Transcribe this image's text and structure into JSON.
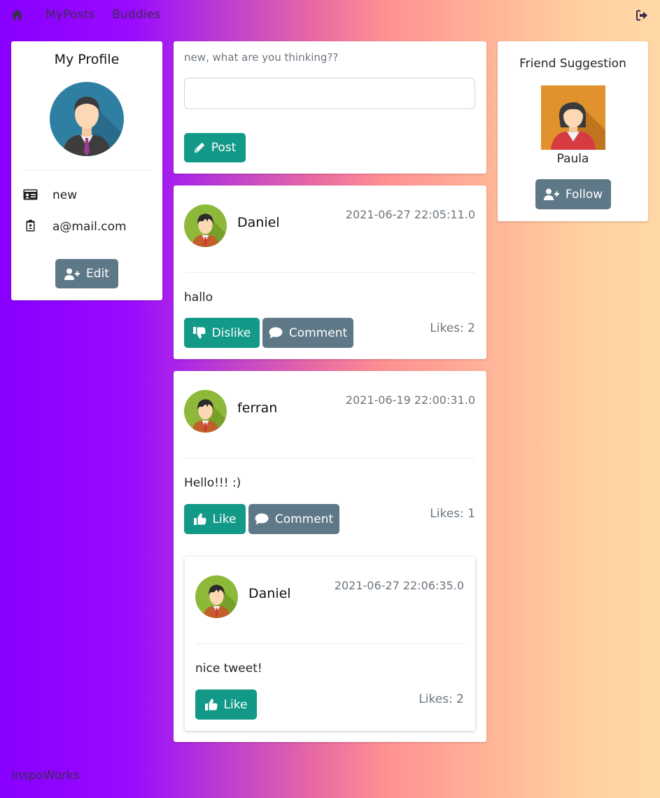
{
  "nav": {
    "home_icon": "home-icon",
    "myposts": "MyPosts",
    "buddies": "Buddies",
    "logout_icon": "sign-out-icon"
  },
  "profile": {
    "title": "My Profile",
    "username": "new",
    "email": "a@mail.com",
    "edit_label": "Edit"
  },
  "composer": {
    "prompt": "new, what are you thinking??",
    "input_value": "",
    "post_label": "Post"
  },
  "posts": [
    {
      "author": "Daniel",
      "timestamp": "2021-06-27 22:05:11.0",
      "text": "hallo",
      "like_label": "Dislike",
      "comment_label": "Comment",
      "likes": "Likes: 2"
    },
    {
      "author": "ferran",
      "timestamp": "2021-06-19 22:00:31.0",
      "text": "Hello!!! :)",
      "like_label": "Like",
      "comment_label": "Comment",
      "likes": "Likes: 1",
      "comment": {
        "author": "Daniel",
        "timestamp": "2021-06-27 22:06:35.0",
        "text": "nice tweet!",
        "like_label": "Like",
        "likes": "Likes: 2"
      }
    }
  ],
  "suggestion": {
    "title": "Friend Suggestion",
    "name": "Paula",
    "follow_label": "Follow"
  },
  "footer": {
    "brand": "InspoWorks"
  },
  "colors": {
    "teal": "#129987",
    "slate": "#5e7887",
    "purple": "#8800ff",
    "peach": "#ffd8a6"
  }
}
